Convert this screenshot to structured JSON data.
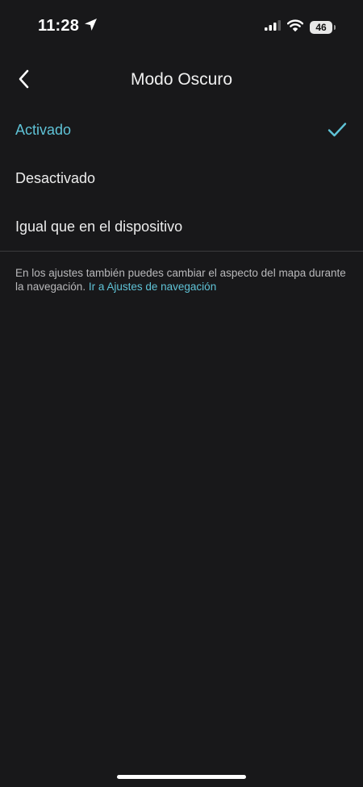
{
  "status_bar": {
    "time": "11:28",
    "location_icon": "location-arrow-icon",
    "signal_icon": "cellular-signal-icon",
    "wifi_icon": "wifi-icon",
    "battery_level": "46"
  },
  "nav": {
    "back_icon": "chevron-left-icon",
    "title": "Modo Oscuro"
  },
  "options": [
    {
      "label": "Activado",
      "selected": true
    },
    {
      "label": "Desactivado",
      "selected": false
    },
    {
      "label": "Igual que en el dispositivo",
      "selected": false
    }
  ],
  "footer": {
    "text": "En los ajustes también puedes cambiar el aspecto del mapa durante la navegación.",
    "link": "Ir a Ajustes de navegación"
  },
  "colors": {
    "background": "#18181a",
    "accent": "#5fc3d7",
    "text": "#ececec"
  }
}
